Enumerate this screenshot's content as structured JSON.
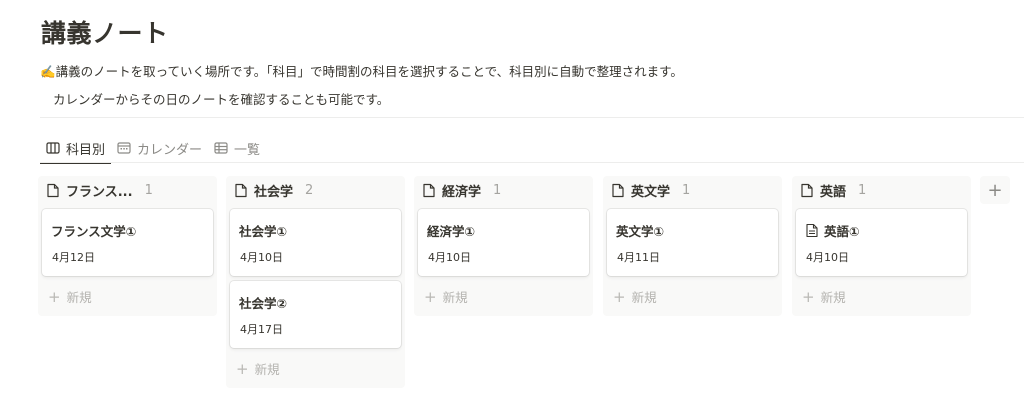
{
  "page": {
    "title": "講義ノート",
    "description_line1": "✍️講義のノートを取っていく場所です。「科目」で時間割の科目を選択することで、科目別に自動で整理されます。",
    "description_line2": "カレンダーからその日のノートを確認することも可能です。"
  },
  "tabs": [
    {
      "label": "科目別",
      "icon": "board-columns-icon",
      "active": true
    },
    {
      "label": "カレンダー",
      "icon": "calendar-icon",
      "active": false
    },
    {
      "label": "一覧",
      "icon": "table-icon",
      "active": false
    }
  ],
  "board": {
    "new_label": "新規",
    "add_column_label": "+",
    "columns": [
      {
        "title": "フランス...",
        "count": "1",
        "cards": [
          {
            "title": "フランス文学①",
            "date": "4月12日"
          }
        ]
      },
      {
        "title": "社会学",
        "count": "2",
        "cards": [
          {
            "title": "社会学①",
            "date": "4月10日"
          },
          {
            "title": "社会学②",
            "date": "4月17日"
          }
        ]
      },
      {
        "title": "経済学",
        "count": "1",
        "cards": [
          {
            "title": "経済学①",
            "date": "4月10日"
          }
        ]
      },
      {
        "title": "英文学",
        "count": "1",
        "cards": [
          {
            "title": "英文学①",
            "date": "4月11日"
          }
        ]
      },
      {
        "title": "英語",
        "count": "1",
        "cards": [
          {
            "title": "英語①",
            "date": "4月10日",
            "has_icon": true
          }
        ]
      }
    ]
  },
  "colors": {
    "text": "#37352f",
    "muted": "#a5a4a0",
    "column_bg": "#f9f9f8"
  }
}
